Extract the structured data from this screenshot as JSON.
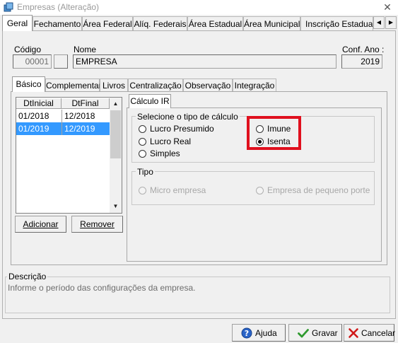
{
  "window": {
    "title": "Empresas (Alteração)",
    "close_glyph": "✕"
  },
  "top_tabs": [
    {
      "label": "Geral",
      "active": true
    },
    {
      "label": "Fechamento"
    },
    {
      "label": "Área Federal"
    },
    {
      "label": "Alíq. Federais"
    },
    {
      "label": "Área Estadual"
    },
    {
      "label": "Área Municipal"
    },
    {
      "label": "Inscrição Estadual S"
    }
  ],
  "top_tabs_scroll": {
    "left_glyph": "◀",
    "right_glyph": "▶"
  },
  "header": {
    "codigo_label": "Código",
    "codigo_value": "00001",
    "nome_label": "Nome",
    "nome_value": "EMPRESA",
    "conf_ano_label": "Conf. Ano :",
    "conf_ano_value": "2019"
  },
  "inner_tabs": [
    {
      "label": "Básico",
      "active": true
    },
    {
      "label": "Complementar"
    },
    {
      "label": "Livros"
    },
    {
      "label": "Centralização"
    },
    {
      "label": "Observação"
    },
    {
      "label": "Integração"
    }
  ],
  "periods": {
    "columns": [
      "DtInicial",
      "DtFinal"
    ],
    "rows": [
      {
        "start": "01/2018",
        "end": "12/2018",
        "selected": false
      },
      {
        "start": "01/2019",
        "end": "12/2019",
        "selected": true
      }
    ],
    "scroll_up": "▲",
    "scroll_down": "▼",
    "add_label": "Adicionar",
    "remove_label": "Remover"
  },
  "calculo_ir": {
    "tab_label": "Cálculo IR",
    "tipo_calculo_title": "Selecione o tipo de cálculo",
    "options_left": [
      "Lucro Presumido",
      "Lucro Real",
      "Simples"
    ],
    "options_right": [
      {
        "label": "Imune",
        "checked": false
      },
      {
        "label": "Isenta",
        "checked": true
      }
    ],
    "tipo_title": "Tipo",
    "tipo_options": [
      "Micro empresa",
      "Empresa de pequeno porte"
    ]
  },
  "descricao": {
    "title": "Descrição",
    "text": "Informe o período das configurações da empresa."
  },
  "buttons": {
    "help": "Ajuda",
    "save": "Gravar",
    "cancel": "Cancelar"
  },
  "colors": {
    "highlight": "#e0101e",
    "selection": "#3399ff"
  }
}
